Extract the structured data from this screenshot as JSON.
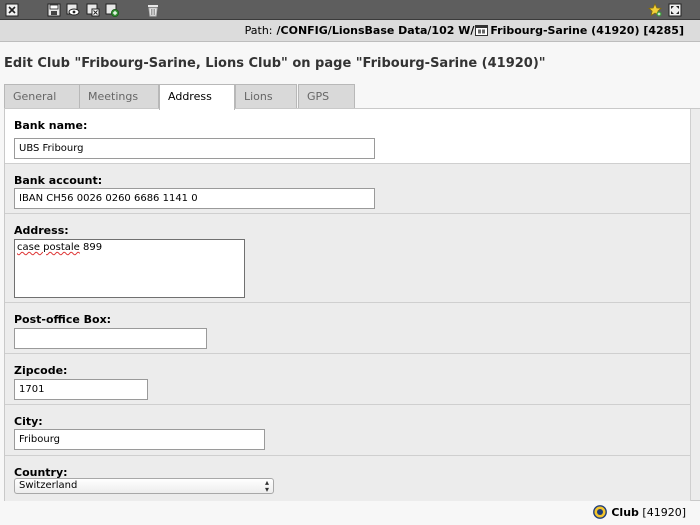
{
  "toolbar": {
    "buttons": [
      {
        "icon": "close-icon"
      },
      {
        "icon": "save-icon"
      },
      {
        "icon": "save-view-icon"
      },
      {
        "icon": "save-close-icon"
      },
      {
        "icon": "save-new-icon"
      },
      {
        "icon": "delete-icon"
      }
    ],
    "right_icons": [
      "shortcut-star-icon",
      "fullscreen-icon"
    ]
  },
  "path": {
    "label": "Path:",
    "value": "/CONFIG/LionsBase Data/102 W/",
    "page": "Fribourg-Sarine (41920) [4285]"
  },
  "header": {
    "title": "Edit Club \"Fribourg-Sarine, Lions Club\" on page \"Fribourg-Sarine (41920)\""
  },
  "tabs": [
    {
      "label": "General",
      "active": false
    },
    {
      "label": "Meetings",
      "active": false
    },
    {
      "label": "Address",
      "active": true
    },
    {
      "label": "Lions",
      "active": false
    },
    {
      "label": "GPS",
      "active": false
    }
  ],
  "fields": {
    "bank_name": {
      "label": "Bank name:",
      "value": "UBS Fribourg"
    },
    "bank_account": {
      "label": "Bank account:",
      "value": "IBAN CH56 0026 0260 6686 1141 0"
    },
    "address": {
      "label": "Address:",
      "value_part1": "case postale",
      "value_part2": " 899"
    },
    "po_box": {
      "label": "Post-office Box:",
      "value": ""
    },
    "zipcode": {
      "label": "Zipcode:",
      "value": "1701"
    },
    "city": {
      "label": "City:",
      "value": "Fribourg"
    },
    "country": {
      "label": "Country:",
      "value": "Switzerland"
    }
  },
  "footer": {
    "record_type": "Club",
    "record_id": "[41920]"
  },
  "colors": {
    "toolbar_bg": "#5e5e5e",
    "pathbar_bg": "#dcdcdc",
    "row_bg": "#ececec"
  }
}
